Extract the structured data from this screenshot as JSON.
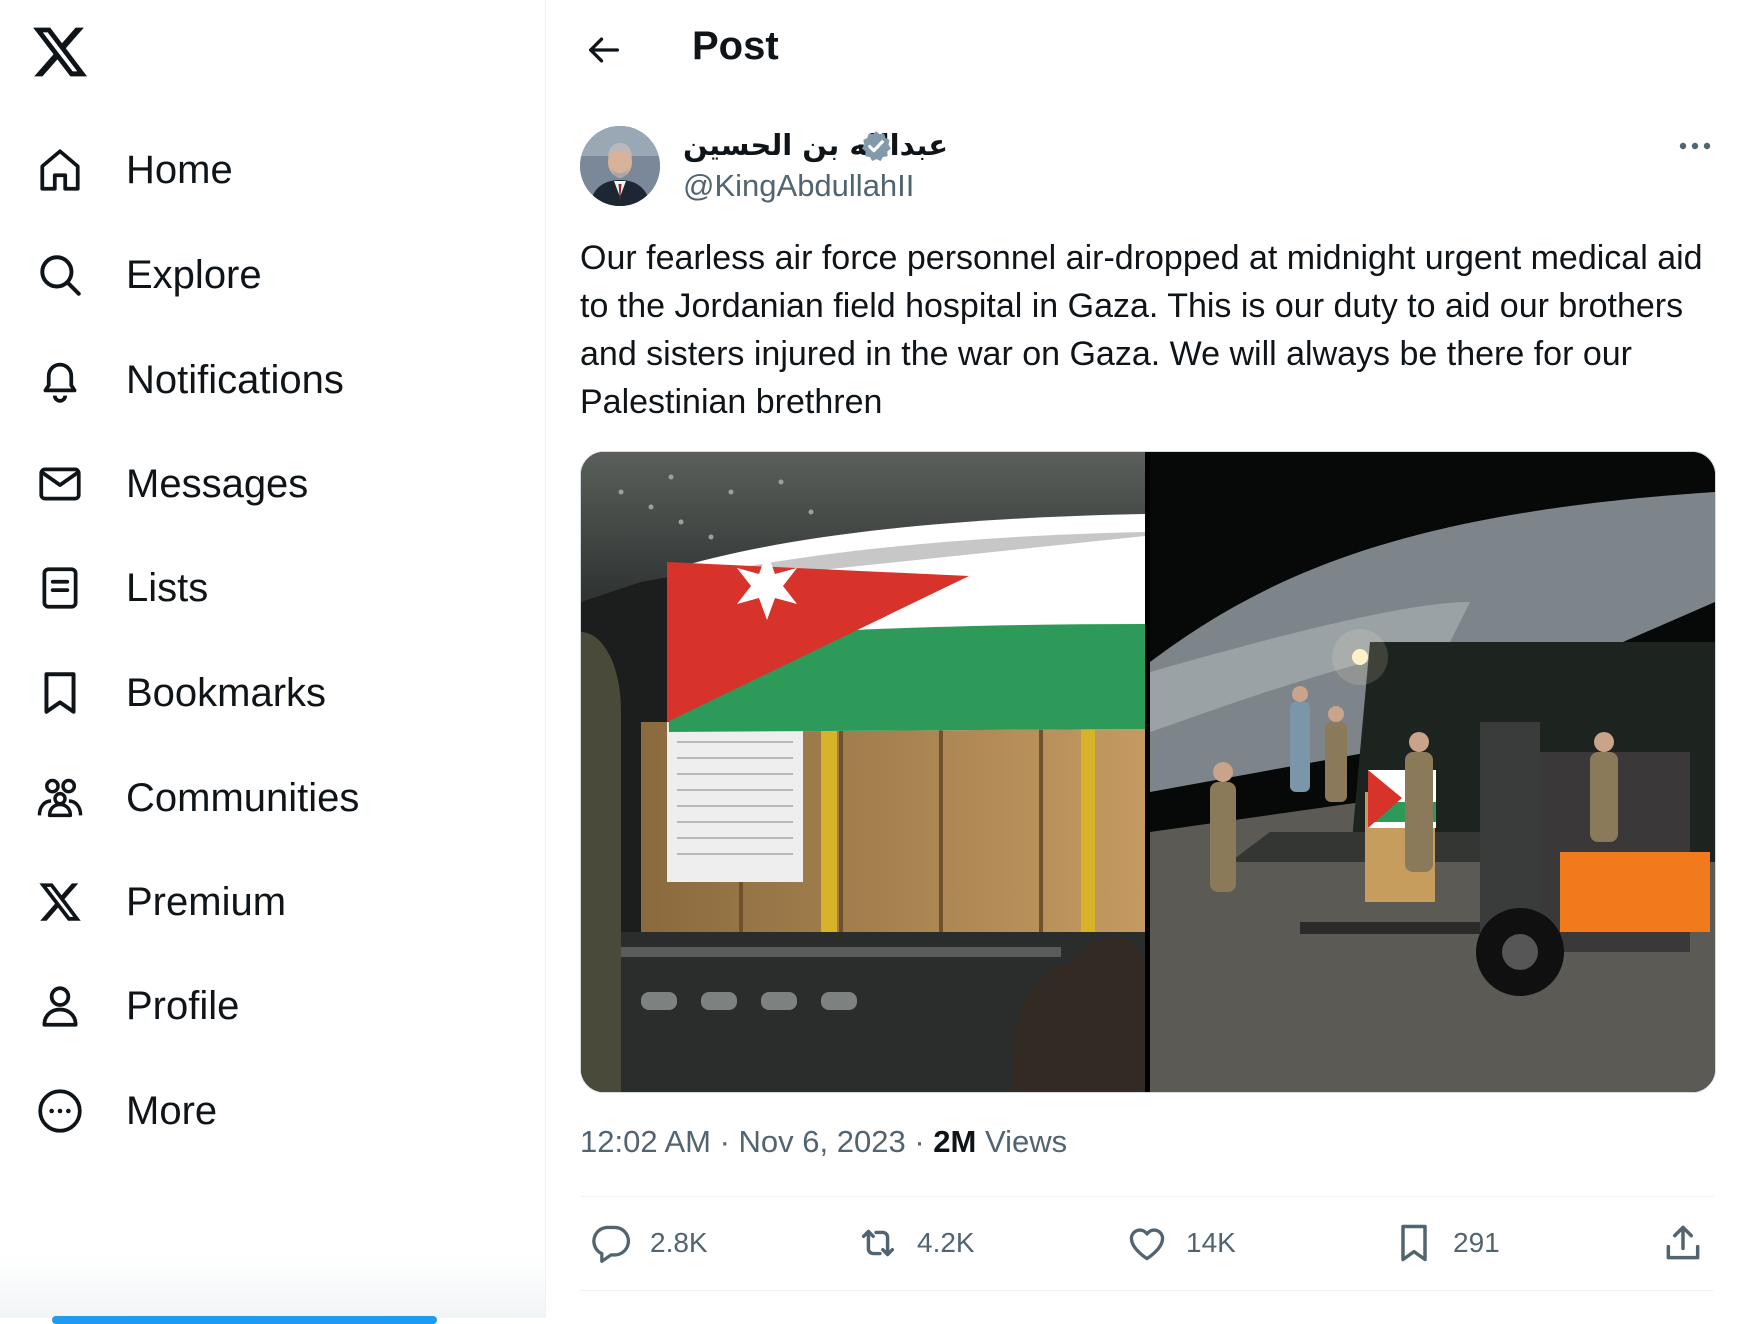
{
  "nav": {
    "items": [
      {
        "label": "Home",
        "icon": "home-icon"
      },
      {
        "label": "Explore",
        "icon": "search-icon"
      },
      {
        "label": "Notifications",
        "icon": "bell-icon"
      },
      {
        "label": "Messages",
        "icon": "envelope-icon"
      },
      {
        "label": "Lists",
        "icon": "list-icon"
      },
      {
        "label": "Bookmarks",
        "icon": "bookmark-icon"
      },
      {
        "label": "Communities",
        "icon": "communities-icon"
      },
      {
        "label": "Premium",
        "icon": "x-logo-icon"
      },
      {
        "label": "Profile",
        "icon": "person-icon"
      },
      {
        "label": "More",
        "icon": "more-circle-icon"
      }
    ]
  },
  "header": {
    "title": "Post"
  },
  "post": {
    "display_name": "عبدالله بن الحسين",
    "verified": true,
    "handle": "@KingAbdullahII",
    "text": "Our fearless air force personnel air-dropped at midnight urgent medical aid to the Jordanian field hospital in Gaza. This is our duty to aid our brothers and sisters injured in the war on Gaza. We will always be there for our Palestinian brethren",
    "time": "12:02 AM",
    "date": "Nov 6, 2023",
    "views_count": "2M",
    "views_label": "Views",
    "replies": "2.8K",
    "reposts": "4.2K",
    "likes": "14K",
    "bookmarks": "291"
  },
  "colors": {
    "text": "#0f1419",
    "secondary": "#536471",
    "verified": "#829aab",
    "accent": "#1d9bf0"
  }
}
